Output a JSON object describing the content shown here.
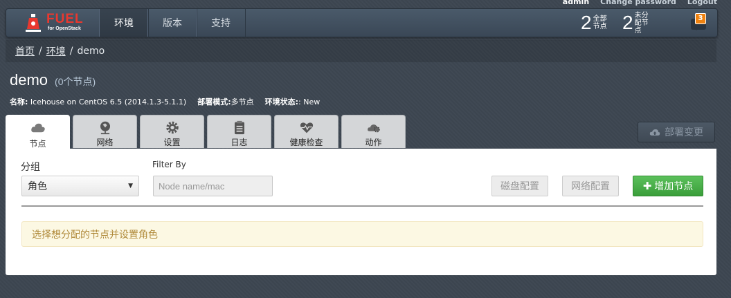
{
  "userbar": {
    "username": "admin",
    "change_password": "Change password",
    "logout": "Logout"
  },
  "navbar": {
    "logo_text": "FUEL",
    "logo_sub": "for OpenStack",
    "tabs": [
      {
        "label": "环境",
        "active": true
      },
      {
        "label": "版本",
        "active": false
      },
      {
        "label": "支持",
        "active": false
      }
    ],
    "stats": [
      {
        "value": "2",
        "label": "全部节点"
      },
      {
        "value": "2",
        "label": "未分配节点"
      }
    ],
    "notification_count": "3"
  },
  "breadcrumb": {
    "home": "首页",
    "environments": "环境",
    "current": "demo"
  },
  "env": {
    "name": "demo",
    "node_count": "(0个节点)",
    "info_name_label": "名称:",
    "info_name_value": "Icehouse on CentOS 6.5 (2014.1.3-5.1.1)",
    "info_mode_label": "部署模式:",
    "info_mode_value": "多节点",
    "info_status_label": "环境状态:",
    "info_status_value": ": New"
  },
  "tabs": [
    {
      "label": "节点",
      "icon": "cloud-icon",
      "active": true
    },
    {
      "label": "网络",
      "icon": "network-icon",
      "active": false
    },
    {
      "label": "设置",
      "icon": "gear-icon",
      "active": false
    },
    {
      "label": "日志",
      "icon": "log-icon",
      "active": false
    },
    {
      "label": "健康检查",
      "icon": "heart-icon",
      "active": false
    },
    {
      "label": "动作",
      "icon": "actions-icon",
      "active": false
    }
  ],
  "deploy_button": "部署变更",
  "nodes": {
    "grouping_label": "分组",
    "grouping_value": "角色",
    "filter_label": "Filter By",
    "filter_placeholder": "Node name/mac",
    "disk_config": "磁盘配置",
    "network_config": "网络配置",
    "add_nodes": "增加节点",
    "alert": "选择想分配的节点并设置角色"
  },
  "colors": {
    "accent_red": "#e8382f",
    "success": "#4cae4c",
    "badge": "#f0820f",
    "alert_bg": "#fcf8e3"
  }
}
